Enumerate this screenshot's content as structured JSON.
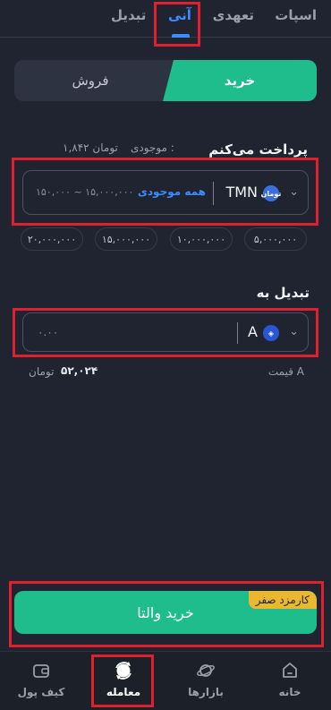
{
  "tabs": [
    {
      "label": "اسپات"
    },
    {
      "label": "تعهدی"
    },
    {
      "label": "آنی"
    },
    {
      "label": "تبدیل"
    }
  ],
  "active_tab": "آنی",
  "trade_toggle": {
    "buy": "خرید",
    "sell": "فروش"
  },
  "pay": {
    "label": "پرداخت می‌کنم",
    "balance_label": "موجودی :",
    "balance_value": "۱,۸۴۲ تومان",
    "currency": "TMN",
    "coin_icon_text": "تومان",
    "max_label": "همه موجودی",
    "range": "۱۵۰,۰۰۰ ~ ۱۵,۰۰۰,۰۰۰"
  },
  "presets": [
    "۵,۰۰۰,۰۰۰",
    "۱۰,۰۰۰,۰۰۰",
    "۱۵,۰۰۰,۰۰۰",
    "۲۰,۰۰۰,۰۰۰"
  ],
  "convert": {
    "label": "تبدیل به",
    "currency": "A",
    "placeholder": "۰.۰۰",
    "price_label": "قیمت A",
    "price_value": "۵۲,۰۲۴",
    "price_unit": "تومان"
  },
  "cta": {
    "label": "خرید والتا",
    "badge": "کارمزد صفر"
  },
  "nav": [
    {
      "label": "خانه",
      "icon": "home-icon"
    },
    {
      "label": "بازارها",
      "icon": "planet-icon"
    },
    {
      "label": "معامله",
      "icon": "trade-icon"
    },
    {
      "label": "کیف پول",
      "icon": "wallet-icon"
    }
  ],
  "colors": {
    "accent": "#3b8cff",
    "buy": "#1fbd8c",
    "badge": "#e8b830",
    "highlight": "#e0202e"
  }
}
